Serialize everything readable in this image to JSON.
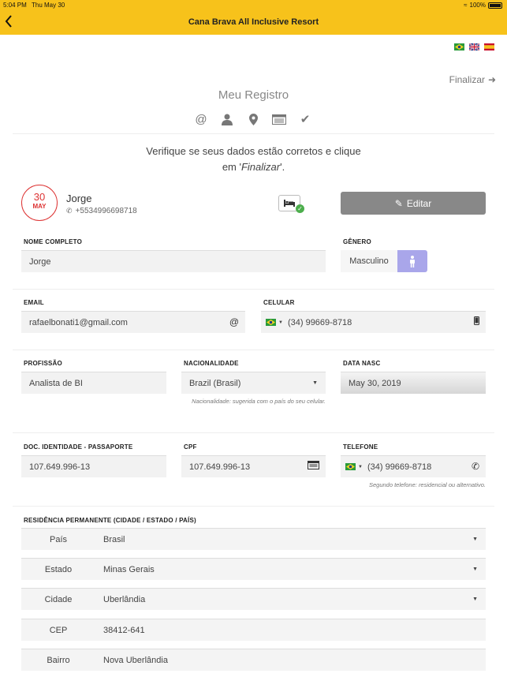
{
  "status": {
    "time": "5:04 PM",
    "date": "Thu May 30",
    "battery": "100%"
  },
  "header": {
    "title": "Cana Brava All Inclusive Resort",
    "back_icon": "chevron-left-icon"
  },
  "languages": [
    "pt-BR",
    "en-GB",
    "es"
  ],
  "finalize_label": "Finalizar",
  "page_title": "Meu Registro",
  "steps": [
    "at-icon",
    "user-icon",
    "map-marker-icon",
    "id-card-icon",
    "check-icon"
  ],
  "verify": {
    "line1": "Verifique se seus dados estão corretos e clique",
    "line2_pre": "em '",
    "line2_em": "Finalizar",
    "line2_post": "'."
  },
  "guest": {
    "day": "30",
    "month": "MAY",
    "name": "Jorge",
    "phone": "+5534996698718"
  },
  "edit_label": "Editar",
  "form": {
    "full_name": {
      "label": "NOME COMPLETO",
      "value": "Jorge"
    },
    "gender": {
      "label": "GÊNERO",
      "value": "Masculino"
    },
    "email": {
      "label": "EMAIL",
      "value": "rafaelbonati1@gmail.com"
    },
    "mobile": {
      "label": "CELULAR",
      "value": "(34) 99669-8718"
    },
    "profession": {
      "label": "PROFISSÃO",
      "value": "Analista de BI"
    },
    "nationality": {
      "label": "NACIONALIDADE",
      "value": "Brazil (Brasil)",
      "hint": "Nacionalidade: sugerida com o país do seu celular."
    },
    "birth": {
      "label": "DATA NASC",
      "value": "May 30, 2019"
    },
    "passport": {
      "label": "DOC. IDENTIDADE - PASSAPORTE",
      "value": "107.649.996-13"
    },
    "cpf": {
      "label": "CPF",
      "value": "107.649.996-13"
    },
    "phone": {
      "label": "TELEFONE",
      "value": "(34) 99669-8718",
      "hint": "Segundo telefone: residencial ou alternativo."
    }
  },
  "residence": {
    "label": "RESIDÊNCIA PERMANENTE (CIDADE / ESTADO / PAÍS)",
    "rows": [
      {
        "label": "País",
        "value": "Brasil"
      },
      {
        "label": "Estado",
        "value": "Minas Gerais"
      },
      {
        "label": "Cidade",
        "value": "Uberlândia"
      },
      {
        "label": "CEP",
        "value": "38412-641"
      },
      {
        "label": "Bairro",
        "value": "Nova Uberlândia"
      }
    ]
  },
  "colors": {
    "header": "#f7c21b",
    "accent_red": "#dd3333",
    "gender_button": "#a9a6ea",
    "edit_button": "#888888"
  }
}
